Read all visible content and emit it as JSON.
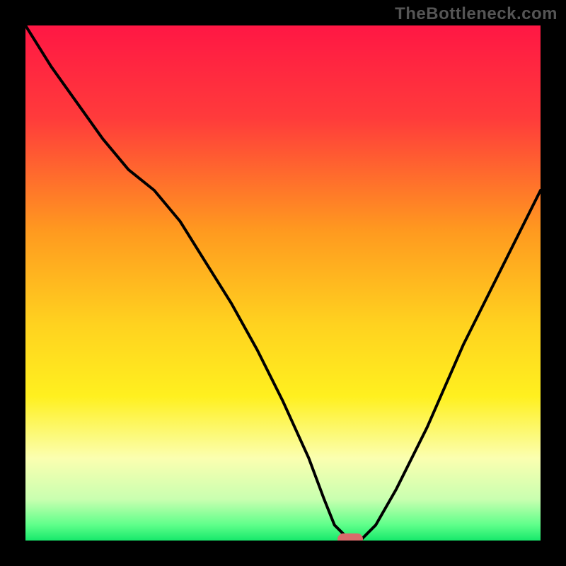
{
  "watermark": "TheBottleneck.com",
  "chart_data": {
    "type": "line",
    "title": "",
    "xlabel": "",
    "ylabel": "",
    "xlim": [
      0,
      100
    ],
    "ylim": [
      0,
      100
    ],
    "grid": false,
    "legend": false,
    "series": [
      {
        "name": "bottleneck-curve",
        "x": [
          0,
          5,
          10,
          15,
          20,
          25,
          30,
          35,
          40,
          45,
          50,
          55,
          58,
          60,
          62,
          63,
          65,
          68,
          72,
          78,
          85,
          92,
          100
        ],
        "y": [
          100,
          92,
          85,
          78,
          72,
          68,
          62,
          54,
          46,
          37,
          27,
          16,
          8,
          3,
          1,
          0,
          0,
          3,
          10,
          22,
          38,
          52,
          68
        ]
      }
    ],
    "marker": {
      "x": 63,
      "y": 0,
      "label": "optimal-point"
    },
    "background_gradient": {
      "stops": [
        {
          "pct": 0,
          "color": "#ff1744"
        },
        {
          "pct": 18,
          "color": "#ff3b3b"
        },
        {
          "pct": 40,
          "color": "#ff9a1f"
        },
        {
          "pct": 58,
          "color": "#ffd21f"
        },
        {
          "pct": 72,
          "color": "#fff01f"
        },
        {
          "pct": 84,
          "color": "#fbffb0"
        },
        {
          "pct": 92,
          "color": "#c9ffb0"
        },
        {
          "pct": 97,
          "color": "#5eff8a"
        },
        {
          "pct": 100,
          "color": "#17e86b"
        }
      ]
    }
  }
}
